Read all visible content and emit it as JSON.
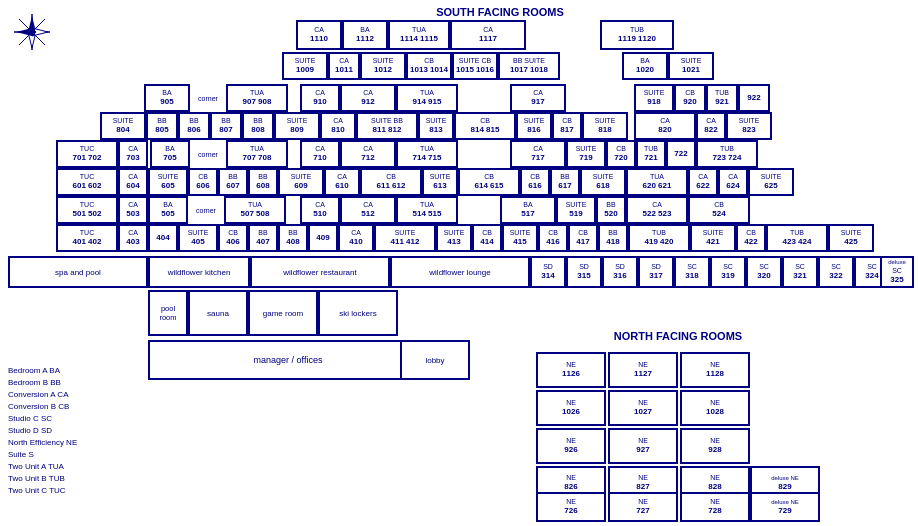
{
  "titles": {
    "south": "SOUTH FACING ROOMS",
    "north": "NORTH FACING ROOMS"
  },
  "legend": {
    "items": [
      "Bedroom A  BA",
      "Bedroom B  BB",
      "Conversion A CA",
      "Conversion B CB",
      "Studio C SC",
      "Studio D SD",
      "North Efficiency NE",
      "Suite S",
      "Two Unit A TUA",
      "Two Unit B TUB",
      "Two Unit C TUC"
    ]
  },
  "labels": {
    "spa_pool": "spa and pool",
    "wildflower_kitchen": "wildflower kitchen",
    "wildflower_restaurant": "wildflower restaurant",
    "wildflower_lounge": "wildflower lounge",
    "pool_room": "pool room",
    "sauna": "sauna",
    "game_room": "game room",
    "ski_lockers": "ski lockers",
    "manager_offices": "manager / offices",
    "lobby": "lobby"
  }
}
